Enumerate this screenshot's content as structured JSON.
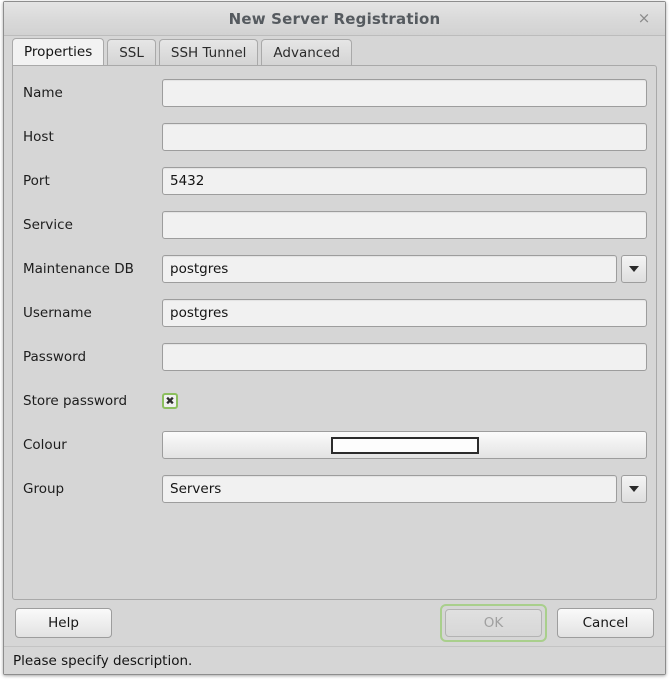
{
  "window": {
    "title": "New Server Registration",
    "close_icon": "close-icon"
  },
  "tabs": [
    {
      "label": "Properties",
      "active": true
    },
    {
      "label": "SSL",
      "active": false
    },
    {
      "label": "SSH Tunnel",
      "active": false
    },
    {
      "label": "Advanced",
      "active": false
    }
  ],
  "form": {
    "name": {
      "label": "Name",
      "value": "",
      "placeholder": ""
    },
    "host": {
      "label": "Host",
      "value": "",
      "placeholder": ""
    },
    "port": {
      "label": "Port",
      "value": "5432",
      "placeholder": ""
    },
    "service": {
      "label": "Service",
      "value": "",
      "placeholder": ""
    },
    "maintenance_db": {
      "label": "Maintenance DB",
      "value": "postgres"
    },
    "username": {
      "label": "Username",
      "value": "postgres",
      "placeholder": ""
    },
    "password": {
      "label": "Password",
      "value": "",
      "placeholder": ""
    },
    "store_password": {
      "label": "Store password",
      "checked": true,
      "mark": "✖"
    },
    "colour": {
      "label": "Colour",
      "swatch_value": ""
    },
    "group": {
      "label": "Group",
      "value": "Servers"
    }
  },
  "buttons": {
    "help": "Help",
    "ok": "OK",
    "cancel": "Cancel"
  },
  "status": {
    "message": "Please specify description."
  },
  "colors": {
    "focus_ring": "#a9cf8c",
    "checkbox_border": "#8cbf5e",
    "window_bg": "#d6d6d6",
    "field_bg": "#f1f1f1"
  }
}
